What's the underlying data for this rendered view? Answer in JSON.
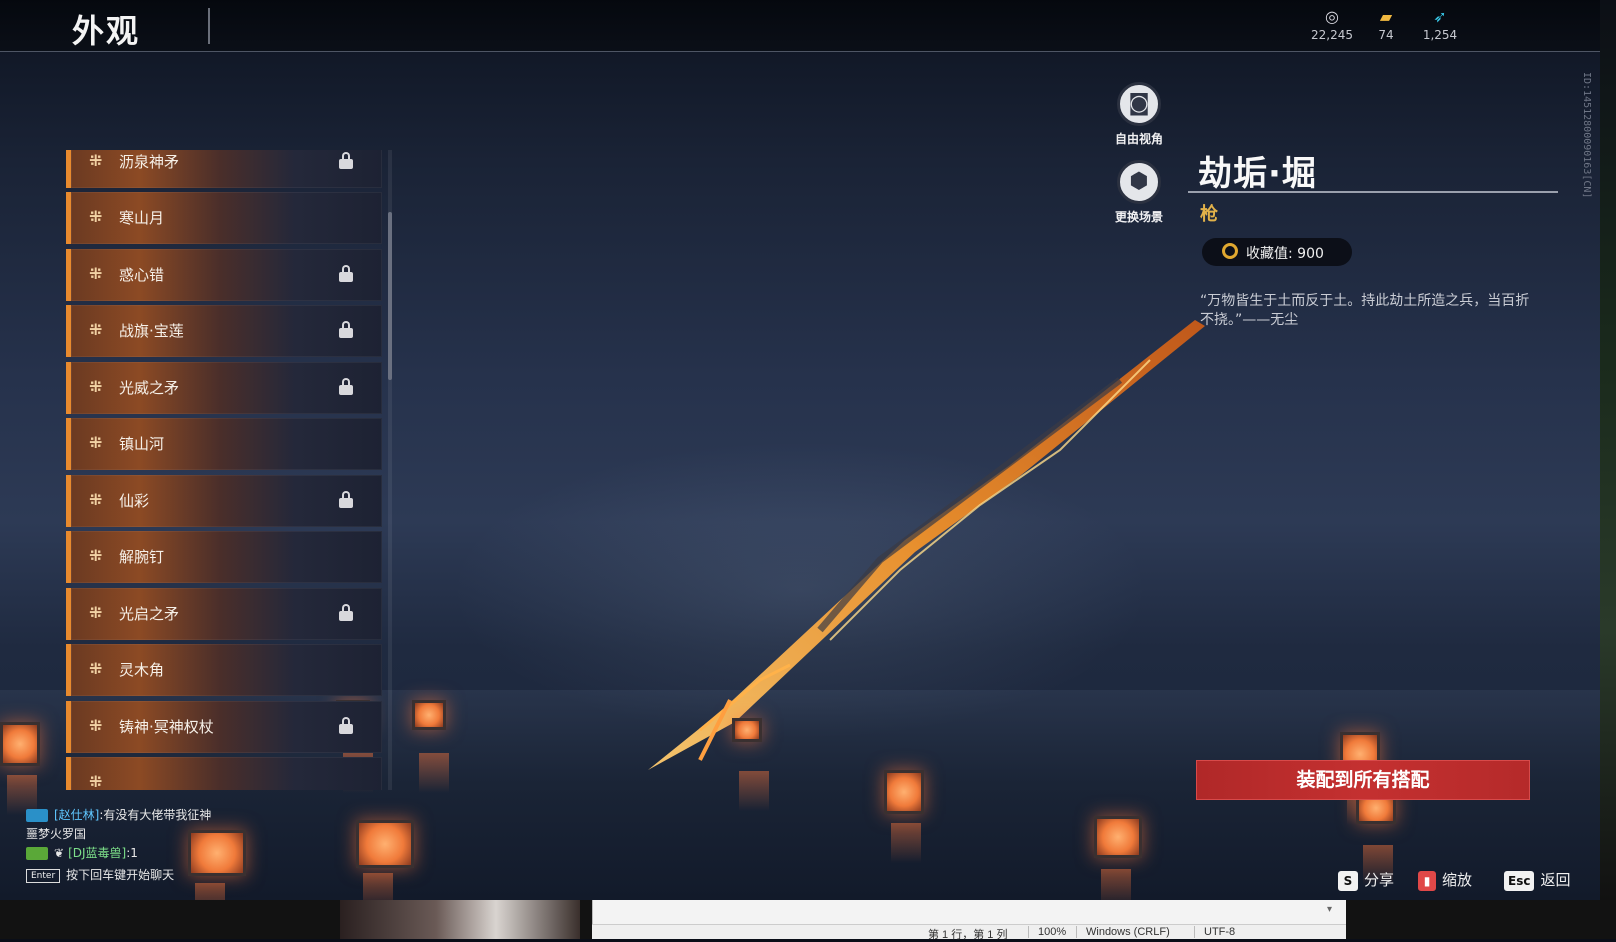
{
  "header": {
    "title": "外观",
    "currencies": [
      {
        "icon": "coin-icon",
        "value": "22,245"
      },
      {
        "icon": "ticket-icon",
        "value": "74"
      },
      {
        "icon": "feather-icon",
        "value": "1,254"
      }
    ],
    "id_text": "ID:1451280009016​3[CN]"
  },
  "list": {
    "items": [
      {
        "label": "沥泉神矛",
        "locked": true
      },
      {
        "label": "寒山月",
        "locked": false
      },
      {
        "label": "惑心错",
        "locked": true
      },
      {
        "label": "战旗·宝莲",
        "locked": true
      },
      {
        "label": "光威之矛",
        "locked": true
      },
      {
        "label": "镇山河",
        "locked": false
      },
      {
        "label": "仙彩",
        "locked": true
      },
      {
        "label": "解腕钉",
        "locked": false
      },
      {
        "label": "光启之矛",
        "locked": true
      },
      {
        "label": "灵木角",
        "locked": false
      },
      {
        "label": "铸神·冥神权杖",
        "locked": true
      }
    ]
  },
  "camera": {
    "free_view": "自由视角",
    "change_scene": "更换场景"
  },
  "detail": {
    "name": "劫垢·堀",
    "type": "枪",
    "collection_label": "收藏值: 900",
    "quote": "“万物皆生于土而反于土。持此劫土所造之兵，当百折不挠。”——无尘",
    "equip_all": "装配到所有搭配"
  },
  "hotkeys": [
    {
      "key": "S",
      "label": "分享"
    },
    {
      "key": "",
      "label": "缩放"
    },
    {
      "key": "Esc",
      "label": "返回"
    }
  ],
  "chat": {
    "line1_user": "[赵仕林]",
    "line1_text": ":有没有大佬带我征神",
    "line2_text": "噩梦火罗国",
    "line3_user": "[DJ蓝毒兽]",
    "line3_text": ":1",
    "hint_key": "Enter",
    "hint_text": "按下回车键开始聊天"
  },
  "os": {
    "position": "第 1 行，第 1 列",
    "zoom": "100%",
    "line_ending": "Windows (CRLF)",
    "encoding": "UTF-8"
  },
  "colors": {
    "accent_orange": "#e88a2e",
    "equip_red": "#c43030",
    "type_gold": "#e2b24a"
  }
}
